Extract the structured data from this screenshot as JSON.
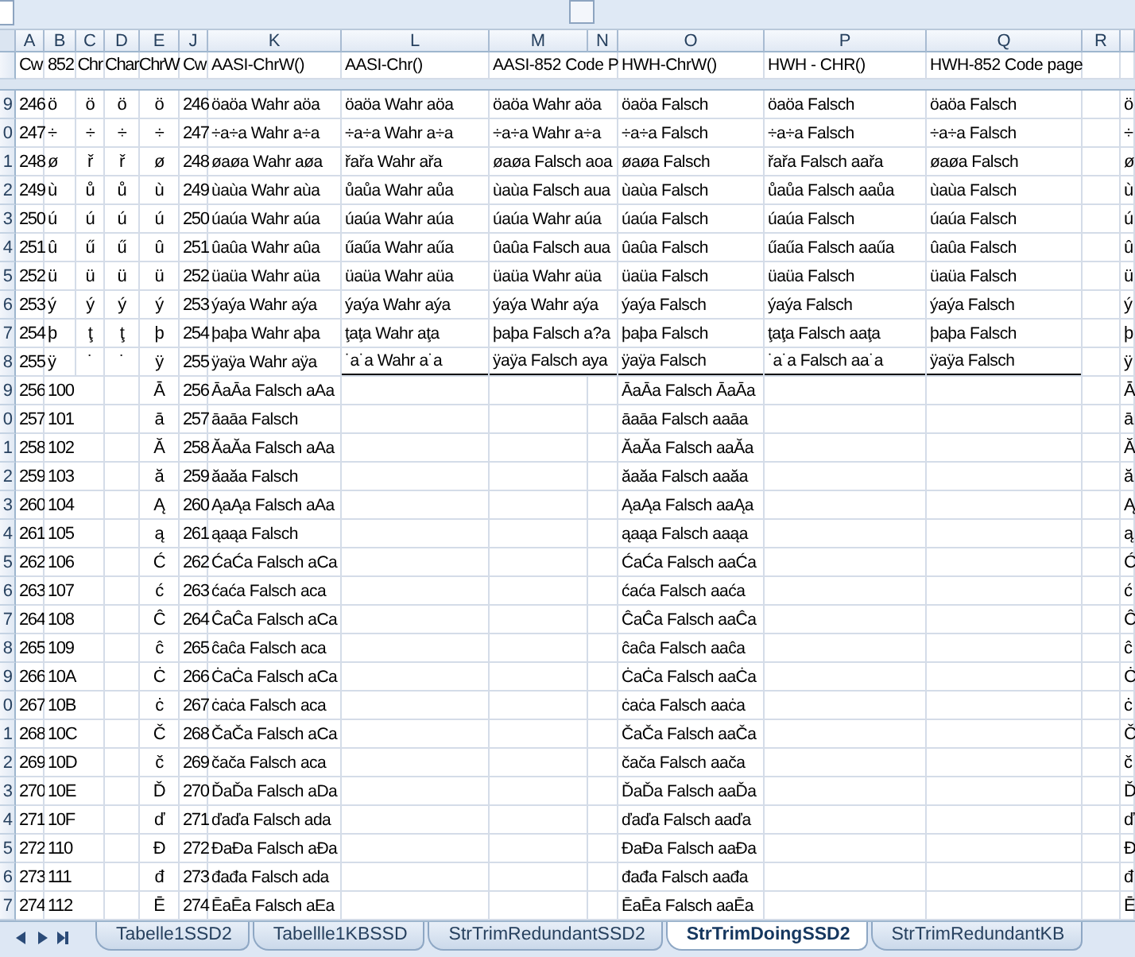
{
  "columns": [
    {
      "letter": "A"
    },
    {
      "letter": "B"
    },
    {
      "letter": "C"
    },
    {
      "letter": "D"
    },
    {
      "letter": "E"
    },
    {
      "letter": "J"
    },
    {
      "letter": "K"
    },
    {
      "letter": "L"
    },
    {
      "letter": "M"
    },
    {
      "letter": "N"
    },
    {
      "letter": "O"
    },
    {
      "letter": "P"
    },
    {
      "letter": "Q"
    },
    {
      "letter": "R"
    }
  ],
  "header_labels": {
    "A": "Cw",
    "B": "852",
    "C": "Chr",
    "D": "Char",
    "E": "ChrW",
    "J": "Cw",
    "K": "AASI-ChrW()",
    "L": "AASI-Chr()",
    "M": "AASI-852 Code P",
    "O": "HWH-ChrW()",
    "P": "HWH - CHR()",
    "Q": "HWH-852 Code page"
  },
  "rows": [
    {
      "row_number": "9",
      "border_below": false,
      "cells": {
        "A": "246",
        "B": "ö",
        "C": "ö",
        "D": "ö",
        "E": "ö",
        "J": "246",
        "K": "öaöa Wahr aöa",
        "L": "öaöa Wahr aöa",
        "M": "öaöa Wahr aöa",
        "O": "öaöa Falsch",
        "P": "öaöa Falsch",
        "Q": "öaöa Falsch",
        "S": "ö"
      }
    },
    {
      "row_number": "0",
      "border_below": false,
      "cells": {
        "A": "247",
        "B": "÷",
        "C": "÷",
        "D": "÷",
        "E": "÷",
        "J": "247",
        "K": "÷a÷a Wahr a÷a",
        "L": "÷a÷a Wahr a÷a",
        "M": "÷a÷a Wahr a÷a",
        "O": "÷a÷a Falsch",
        "P": "÷a÷a Falsch",
        "Q": "÷a÷a Falsch",
        "S": "÷"
      }
    },
    {
      "row_number": "1",
      "border_below": false,
      "cells": {
        "A": "248",
        "B": "ø",
        "C": "ř",
        "D": "ř",
        "E": "ø",
        "J": "248",
        "K": "øaøa Wahr aøa",
        "L": "řařa Wahr ařa",
        "M": "øaøa Falsch aoa",
        "O": "øaøa Falsch",
        "P": "řařa Falsch aařa",
        "Q": "øaøa Falsch",
        "S": "ø"
      }
    },
    {
      "row_number": "2",
      "border_below": false,
      "cells": {
        "A": "249",
        "B": "ù",
        "C": "ů",
        "D": "ů",
        "E": "ù",
        "J": "249",
        "K": "ùaùa Wahr aùa",
        "L": "ůaůa Wahr aůa",
        "M": "ùaùa Falsch aua",
        "O": "ùaùa Falsch",
        "P": "ůaůa Falsch aaůa",
        "Q": "ùaùa Falsch",
        "S": "ù"
      }
    },
    {
      "row_number": "3",
      "border_below": false,
      "cells": {
        "A": "250",
        "B": "ú",
        "C": "ú",
        "D": "ú",
        "E": "ú",
        "J": "250",
        "K": "úaúa Wahr aúa",
        "L": "úaúa Wahr aúa",
        "M": "úaúa Wahr aúa",
        "O": "úaúa Falsch",
        "P": "úaúa Falsch",
        "Q": "úaúa Falsch",
        "S": "ú"
      }
    },
    {
      "row_number": "4",
      "border_below": false,
      "cells": {
        "A": "251",
        "B": "û",
        "C": "ű",
        "D": "ű",
        "E": "û",
        "J": "251",
        "K": "ûaûa Wahr aûa",
        "L": "űaűa Wahr aűa",
        "M": "ûaûa Falsch aua",
        "O": "ûaûa Falsch",
        "P": "űaűa Falsch aaűa",
        "Q": "ûaûa Falsch",
        "S": "û"
      }
    },
    {
      "row_number": "5",
      "border_below": false,
      "cells": {
        "A": "252",
        "B": "ü",
        "C": "ü",
        "D": "ü",
        "E": "ü",
        "J": "252",
        "K": "üaüa Wahr aüa",
        "L": "üaüa Wahr aüa",
        "M": "üaüa Wahr aüa",
        "O": "üaüa Falsch",
        "P": "üaüa Falsch",
        "Q": "üaüa Falsch",
        "S": "ü"
      }
    },
    {
      "row_number": "6",
      "border_below": false,
      "cells": {
        "A": "253",
        "B": "ý",
        "C": "ý",
        "D": "ý",
        "E": "ý",
        "J": "253",
        "K": "ýaýa Wahr aýa",
        "L": "ýaýa Wahr aýa",
        "M": "ýaýa Wahr aýa",
        "O": "ýaýa Falsch",
        "P": "ýaýa Falsch",
        "Q": "ýaýa Falsch",
        "S": "ý"
      }
    },
    {
      "row_number": "7",
      "border_below": false,
      "cells": {
        "A": "254",
        "B": "þ",
        "C": "ţ",
        "D": "ţ",
        "E": "þ",
        "J": "254",
        "K": "þaþa Wahr aþa",
        "L": "ţaţa Wahr aţa",
        "M": "þaþa Falsch a?a",
        "O": "þaþa Falsch",
        "P": "ţaţa Falsch aaţa",
        "Q": "þaþa Falsch",
        "S": "þ"
      }
    },
    {
      "row_number": "8",
      "border_below": true,
      "cells": {
        "A": "255",
        "B": "ÿ",
        "C": "˙",
        "D": "˙",
        "E": "ÿ",
        "J": "255",
        "K": "ÿaÿa Wahr aÿa",
        "L": "˙a˙a Wahr a˙a",
        "M": "ÿaÿa Falsch aya",
        "O": "ÿaÿa Falsch",
        "P": "˙a˙a Falsch aa˙a",
        "Q": "ÿaÿa Falsch",
        "S": "ÿ"
      }
    },
    {
      "row_number": "9",
      "border_below": false,
      "cells": {
        "A": "256",
        "B": "100",
        "E": "Ā",
        "J": "256",
        "K": "ĀaĀa Falsch aAa",
        "O": "ĀaĀa Falsch ĀaĀa",
        "S": "Ā"
      }
    },
    {
      "row_number": "0",
      "border_below": false,
      "cells": {
        "A": "257",
        "B": "101",
        "E": "ā",
        "J": "257",
        "K": "āaāa Falsch",
        "O": "āaāa Falsch aaāa",
        "S": "ā"
      }
    },
    {
      "row_number": "1",
      "border_below": false,
      "cells": {
        "A": "258",
        "B": "102",
        "E": "Ă",
        "J": "258",
        "K": "ĂaĂa Falsch aAa",
        "O": "ĂaĂa Falsch aaĂa",
        "S": "Ă"
      }
    },
    {
      "row_number": "2",
      "border_below": false,
      "cells": {
        "A": "259",
        "B": "103",
        "E": "ă",
        "J": "259",
        "K": "ăaăa Falsch",
        "O": "ăaăa Falsch aaăa",
        "S": "ă"
      }
    },
    {
      "row_number": "3",
      "border_below": false,
      "cells": {
        "A": "260",
        "B": "104",
        "E": "Ą",
        "J": "260",
        "K": "ĄaĄa Falsch aAa",
        "O": "ĄaĄa Falsch aaĄa",
        "S": "Ą"
      }
    },
    {
      "row_number": "4",
      "border_below": false,
      "cells": {
        "A": "261",
        "B": "105",
        "E": "ą",
        "J": "261",
        "K": "ąaąa Falsch",
        "O": "ąaąa Falsch aaąa",
        "S": "ą"
      }
    },
    {
      "row_number": "5",
      "border_below": false,
      "cells": {
        "A": "262",
        "B": "106",
        "E": "Ć",
        "J": "262",
        "K": "ĆaĆa Falsch aCa",
        "O": "ĆaĆa Falsch aaĆa",
        "S": "Ć"
      }
    },
    {
      "row_number": "6",
      "border_below": false,
      "cells": {
        "A": "263",
        "B": "107",
        "E": "ć",
        "J": "263",
        "K": "ćaća Falsch aca",
        "O": "ćaća Falsch aaća",
        "S": "ć"
      }
    },
    {
      "row_number": "7",
      "border_below": false,
      "cells": {
        "A": "264",
        "B": "108",
        "E": "Ĉ",
        "J": "264",
        "K": "ĈaĈa Falsch aCa",
        "O": "ĈaĈa Falsch aaĈa",
        "S": "Ĉ"
      }
    },
    {
      "row_number": "8",
      "border_below": false,
      "cells": {
        "A": "265",
        "B": "109",
        "E": "ĉ",
        "J": "265",
        "K": "ĉaĉa Falsch aca",
        "O": "ĉaĉa Falsch aaĉa",
        "S": "ĉ"
      }
    },
    {
      "row_number": "9",
      "border_below": false,
      "cells": {
        "A": "266",
        "B": "10A",
        "E": "Ċ",
        "J": "266",
        "K": "ĊaĊa Falsch aCa",
        "O": "ĊaĊa Falsch aaĊa",
        "S": "Ċ"
      }
    },
    {
      "row_number": "0",
      "border_below": false,
      "cells": {
        "A": "267",
        "B": "10B",
        "E": "ċ",
        "J": "267",
        "K": "ċaċa Falsch aca",
        "O": "ċaċa Falsch aaċa",
        "S": "ċ"
      }
    },
    {
      "row_number": "1",
      "border_below": false,
      "cells": {
        "A": "268",
        "B": "10C",
        "E": "Č",
        "J": "268",
        "K": "ČaČa Falsch aCa",
        "O": "ČaČa Falsch aaČa",
        "S": "Č"
      }
    },
    {
      "row_number": "2",
      "border_below": false,
      "cells": {
        "A": "269",
        "B": "10D",
        "E": "č",
        "J": "269",
        "K": "čača Falsch aca",
        "O": "čača Falsch aača",
        "S": "č"
      }
    },
    {
      "row_number": "3",
      "border_below": false,
      "cells": {
        "A": "270",
        "B": "10E",
        "E": "Ď",
        "J": "270",
        "K": "ĎaĎa Falsch aDa",
        "O": "ĎaĎa Falsch aaĎa",
        "S": "Ď"
      }
    },
    {
      "row_number": "4",
      "border_below": false,
      "cells": {
        "A": "271",
        "B": "10F",
        "E": "ď",
        "J": "271",
        "K": "ďaďa Falsch ada",
        "O": "ďaďa Falsch aaďa",
        "S": "ď"
      }
    },
    {
      "row_number": "5",
      "border_below": false,
      "cells": {
        "A": "272",
        "B": "110",
        "E": "Đ",
        "J": "272",
        "K": "ĐaĐa Falsch aĐa",
        "O": "ĐaĐa Falsch aaĐa",
        "S": "Đ"
      }
    },
    {
      "row_number": "6",
      "border_below": false,
      "cells": {
        "A": "273",
        "B": "111",
        "E": "đ",
        "J": "273",
        "K": "đađa Falsch ada",
        "O": "đađa Falsch aađa",
        "S": "đ"
      }
    },
    {
      "row_number": "7",
      "border_below": false,
      "cells": {
        "A": "274",
        "B": "112",
        "E": "Ē",
        "J": "274",
        "K": "ĒaĒa Falsch aEa",
        "O": "ĒaĒa Falsch aaĒa",
        "S": "Ē"
      }
    }
  ],
  "sheet_tabs": [
    {
      "label": "Tabelle1SSD2",
      "selected": false
    },
    {
      "label": "Tabellle1KBSSD",
      "selected": false
    },
    {
      "label": "StrTrimRedundantSSD2",
      "selected": false
    },
    {
      "label": "StrTrimDoingSSD2",
      "selected": true
    },
    {
      "label": "StrTrimRedundantKB",
      "selected": false
    }
  ]
}
